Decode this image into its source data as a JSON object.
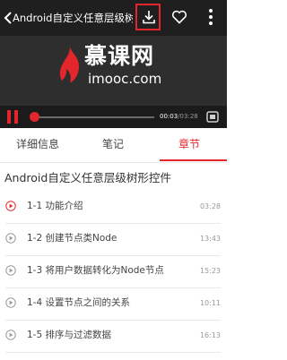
{
  "player": {
    "title": "Android自定义任意层级树形...",
    "logo_cn": "慕课网",
    "logo_en": "imooc.com",
    "time_current": "00:03",
    "time_total": "03:28",
    "progress_fraction": 0.02,
    "accent_color": "#e2262c"
  },
  "tabs": [
    {
      "label": "详细信息",
      "active": false
    },
    {
      "label": "笔记",
      "active": false
    },
    {
      "label": "章节",
      "active": true
    }
  ],
  "course_title": "Android自定义任意层级树形控件",
  "lessons": [
    {
      "title": "1-1 功能介绍",
      "duration": "03:28",
      "active": true
    },
    {
      "title": "1-2 创建节点类Node",
      "duration": "13:43",
      "active": false
    },
    {
      "title": "1-3 将用户数据转化为Node节点",
      "duration": "15:23",
      "active": false
    },
    {
      "title": "1-4 设置节点之间的关系",
      "duration": "10:11",
      "active": false
    },
    {
      "title": "1-5 排序与过滤数据",
      "duration": "16:13",
      "active": false
    }
  ]
}
